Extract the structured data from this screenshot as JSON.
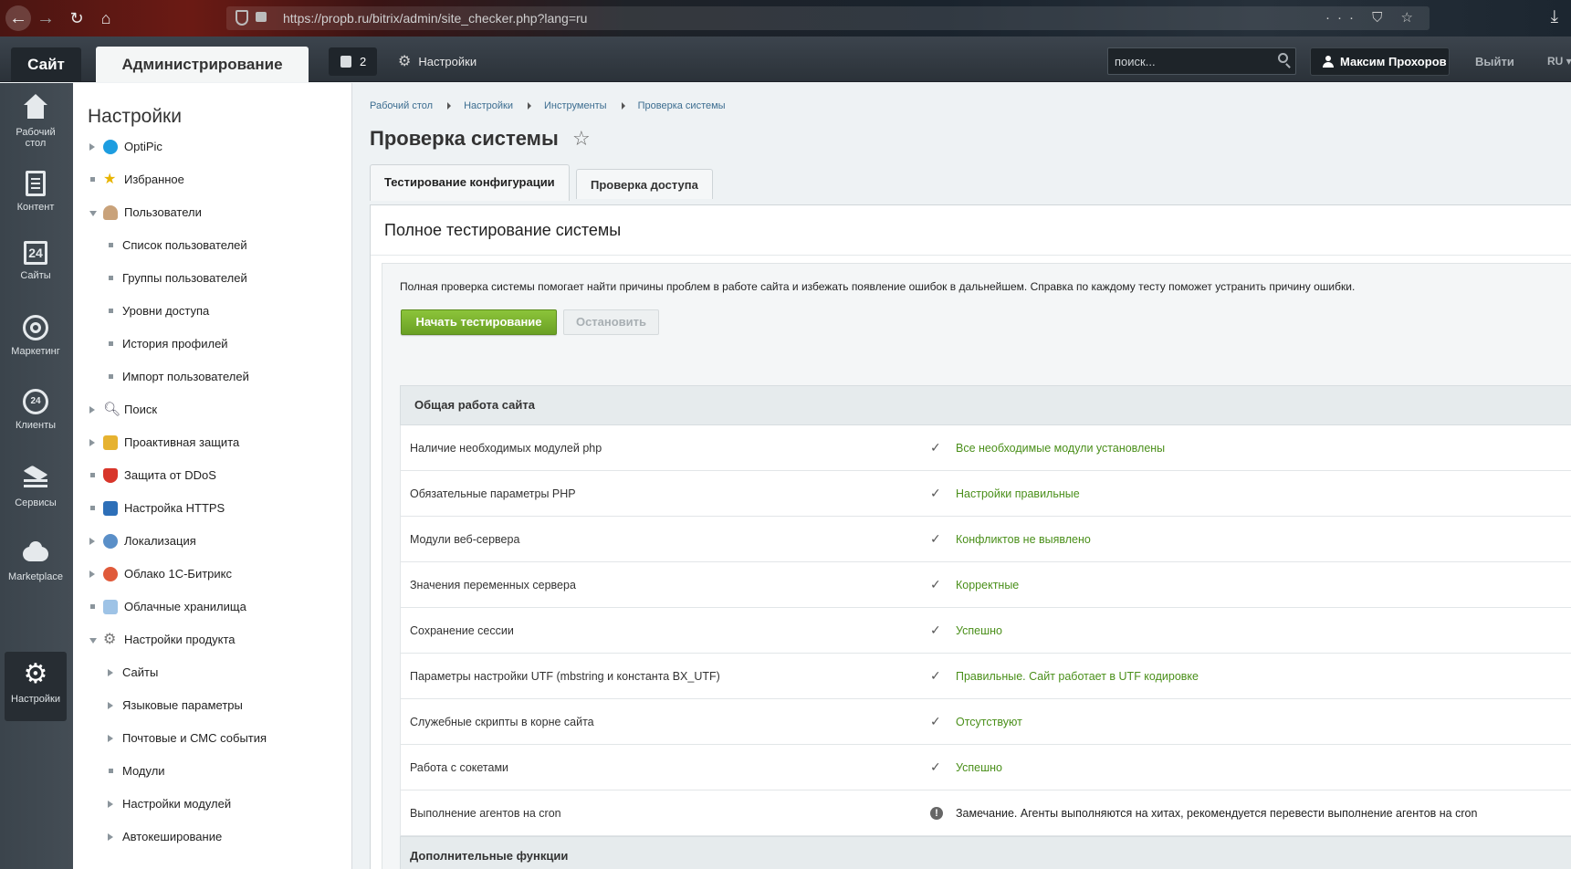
{
  "browser": {
    "url": "https://propb.ru/bitrix/admin/site_checker.php?lang=ru",
    "url_icons": "··· ⛉ ☆"
  },
  "header": {
    "tab_site": "Сайт",
    "tab_admin": "Администрирование",
    "notifications_count": "2",
    "settings_label": "Настройки",
    "search_placeholder": "поиск...",
    "user_name": "Максим Прохоров",
    "logout": "Выйти",
    "lang": "RU"
  },
  "iconpanel": {
    "items": [
      {
        "label": "Рабочий стол",
        "icon": "home-icon"
      },
      {
        "label": "Контент",
        "icon": "document-icon"
      },
      {
        "label": "Сайты",
        "icon": "calendar-24-icon"
      },
      {
        "label": "Маркетинг",
        "icon": "target-icon"
      },
      {
        "label": "Клиенты",
        "icon": "clients-24-icon"
      },
      {
        "label": "Сервисы",
        "icon": "layers-icon"
      },
      {
        "label": "Marketplace",
        "icon": "cloud-download-icon"
      },
      {
        "label": "Настройки",
        "icon": "gear-icon",
        "active": true
      }
    ]
  },
  "tree": {
    "title": "Настройки",
    "items": [
      {
        "label": "OptiPic",
        "marker": "arrow",
        "icon": "optipic-icon"
      },
      {
        "label": "Избранное",
        "marker": "dot",
        "icon": "star-icon"
      },
      {
        "label": "Пользователи",
        "marker": "arrow-open",
        "icon": "user-icon"
      },
      {
        "label": "Список пользователей",
        "sub": true
      },
      {
        "label": "Группы пользователей",
        "sub": true
      },
      {
        "label": "Уровни доступа",
        "sub": true
      },
      {
        "label": "История профилей",
        "sub": true
      },
      {
        "label": "Импорт пользователей",
        "sub": true
      },
      {
        "label": "Поиск",
        "marker": "arrow",
        "icon": "magnifier-icon"
      },
      {
        "label": "Проактивная защита",
        "marker": "arrow",
        "icon": "lock-icon"
      },
      {
        "label": "Защита от DDoS",
        "marker": "dot",
        "icon": "shield-icon"
      },
      {
        "label": "Настройка HTTPS",
        "marker": "dot",
        "icon": "https-icon"
      },
      {
        "label": "Локализация",
        "marker": "arrow",
        "icon": "globe-icon"
      },
      {
        "label": "Облако 1С-Битрикс",
        "marker": "arrow",
        "icon": "cloud-icon"
      },
      {
        "label": "Облачные хранилища",
        "marker": "dot",
        "icon": "storage-icon"
      },
      {
        "label": "Настройки продукта",
        "marker": "arrow-open",
        "icon": "settings-icon"
      },
      {
        "label": "Сайты",
        "sub": true,
        "marker": "arrow"
      },
      {
        "label": "Языковые параметры",
        "sub": true,
        "marker": "arrow"
      },
      {
        "label": "Почтовые и СМС события",
        "sub": true,
        "marker": "arrow"
      },
      {
        "label": "Модули",
        "sub": true,
        "marker": "dot"
      },
      {
        "label": "Настройки модулей",
        "sub": true,
        "marker": "arrow"
      },
      {
        "label": "Автокеширование",
        "sub": true,
        "marker": "arrow"
      }
    ]
  },
  "main": {
    "breadcrumb": [
      "Рабочий стол",
      "Настройки",
      "Инструменты",
      "Проверка системы"
    ],
    "title": "Проверка системы",
    "tabs": [
      {
        "label": "Тестирование конфигурации",
        "active": true
      },
      {
        "label": "Проверка доступа",
        "active": false
      }
    ],
    "panel_title": "Полное тестирование системы",
    "intro": "Полная проверка системы помогает найти причины проблем в работе сайта и избежать появление ошибок в дальнейшем. Справка по каждому тесту поможет устранить причину ошибки.",
    "start_button": "Начать тестирование",
    "stop_button": "Остановить",
    "section1": "Общая работа сайта",
    "rows": [
      {
        "name": "Наличие необходимых модулей php",
        "status": "ok",
        "result": "Все необходимые модули установлены"
      },
      {
        "name": "Обязательные параметры PHP",
        "status": "ok",
        "result": "Настройки правильные"
      },
      {
        "name": "Модули веб-сервера",
        "status": "ok",
        "result": "Конфликтов не выявлено"
      },
      {
        "name": "Значения переменных сервера",
        "status": "ok",
        "result": "Корректные"
      },
      {
        "name": "Сохранение сессии",
        "status": "ok",
        "result": "Успешно"
      },
      {
        "name": "Параметры настройки UTF (mbstring и константа BX_UTF)",
        "status": "ok",
        "result": "Правильные. Сайт работает в UTF кодировке"
      },
      {
        "name": "Служебные скрипты в корне сайта",
        "status": "ok",
        "result": "Отсутствуют"
      },
      {
        "name": "Работа с сокетами",
        "status": "ok",
        "result": "Успешно"
      },
      {
        "name": "Выполнение агентов на cron",
        "status": "warning",
        "result": "Замечание. Агенты выполняются на хитах, рекомендуется перевести выполнение агентов на cron"
      }
    ],
    "section2": "Дополнительные функции"
  }
}
